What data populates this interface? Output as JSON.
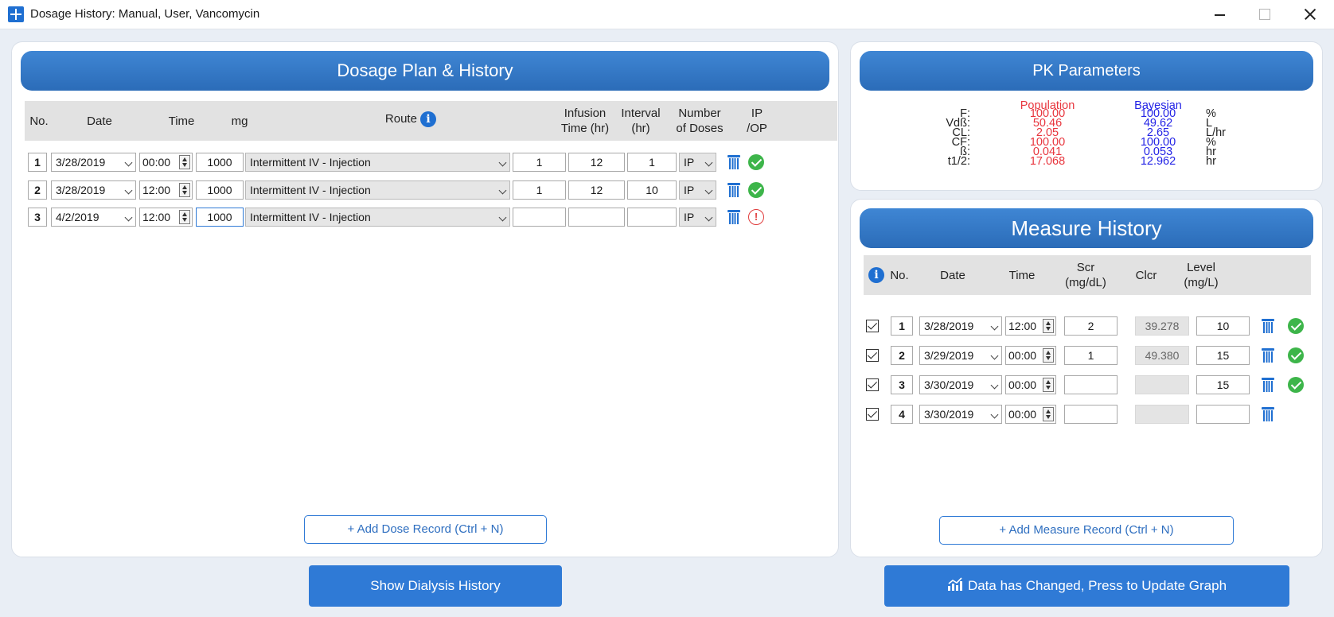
{
  "window": {
    "title": "Dosage History:  Manual, User, Vancomycin"
  },
  "dosage": {
    "header": "Dosage Plan & History",
    "columns": {
      "no": "No.",
      "date": "Date",
      "time": "Time",
      "mg": "mg",
      "route": "Route",
      "infusion1": "Infusion",
      "infusion2": "Time (hr)",
      "interval1": "Interval",
      "interval2": "(hr)",
      "number1": "Number",
      "number2": "of Doses",
      "ip1": "IP",
      "ip2": "/OP"
    },
    "info_icon": "info-icon",
    "rows": [
      {
        "no": "1",
        "date": "3/28/2019",
        "time": "00:00",
        "mg": "1000",
        "route": "Intermittent IV - Injection",
        "infusion": "1",
        "interval": "12",
        "doses": "1",
        "ip": "IP",
        "status": "ok"
      },
      {
        "no": "2",
        "date": "3/28/2019",
        "time": "12:00",
        "mg": "1000",
        "route": "Intermittent IV - Injection",
        "infusion": "1",
        "interval": "12",
        "doses": "10",
        "ip": "IP",
        "status": "ok"
      },
      {
        "no": "3",
        "date": "4/2/2019",
        "time": "12:00",
        "mg": "1000",
        "route": "Intermittent IV - Injection",
        "infusion": "",
        "interval": "",
        "doses": "",
        "ip": "IP",
        "status": "warning"
      }
    ],
    "add_button": "+ Add Dose Record (Ctrl + N)",
    "dialysis_button": "Show Dialysis History"
  },
  "pk": {
    "header": "PK Parameters",
    "population_label": "Population",
    "bayesian_label": "Bayesian",
    "colors": {
      "population": "#e8353d",
      "bayesian": "#2323e6"
    },
    "rows": [
      {
        "name": "F:",
        "population": "100.00",
        "bayesian": "100.00",
        "unit": "%"
      },
      {
        "name": "Vdß:",
        "population": "50.46",
        "bayesian": "49.62",
        "unit": "L"
      },
      {
        "name": "CL:",
        "population": "2.05",
        "bayesian": "2.65",
        "unit": "L/hr"
      },
      {
        "name": "CF:",
        "population": "100.00",
        "bayesian": "100.00",
        "unit": "%"
      },
      {
        "name": "ß:",
        "population": "0.041",
        "bayesian": "0.053",
        "unit": "hr"
      },
      {
        "name": "t1/2:",
        "population": "17.068",
        "bayesian": "12.962",
        "unit": "hr"
      }
    ]
  },
  "measure": {
    "header": "Measure History",
    "columns": {
      "no": "No.",
      "date": "Date",
      "time": "Time",
      "scr1": "Scr",
      "scr2": "(mg/dL)",
      "clcr": "Clcr",
      "level1": "Level",
      "level2": "(mg/L)"
    },
    "rows": [
      {
        "no": "1",
        "date": "3/28/2019",
        "time": "12:00",
        "scr": "2",
        "clcr": "39.278",
        "level": "10",
        "checked": true,
        "status": "ok"
      },
      {
        "no": "2",
        "date": "3/29/2019",
        "time": "00:00",
        "scr": "1",
        "clcr": "49.380",
        "level": "15",
        "checked": true,
        "status": "ok"
      },
      {
        "no": "3",
        "date": "3/30/2019",
        "time": "00:00",
        "scr": "",
        "clcr": "",
        "level": "15",
        "checked": true,
        "status": "ok"
      },
      {
        "no": "4",
        "date": "3/30/2019",
        "time": "00:00",
        "scr": "",
        "clcr": "",
        "level": "",
        "checked": true,
        "status": "none"
      }
    ],
    "add_button": "+ Add Measure Record (Ctrl + N)",
    "update_button": "Data has Changed, Press to Update Graph",
    "update_icon": "chart-icon"
  }
}
